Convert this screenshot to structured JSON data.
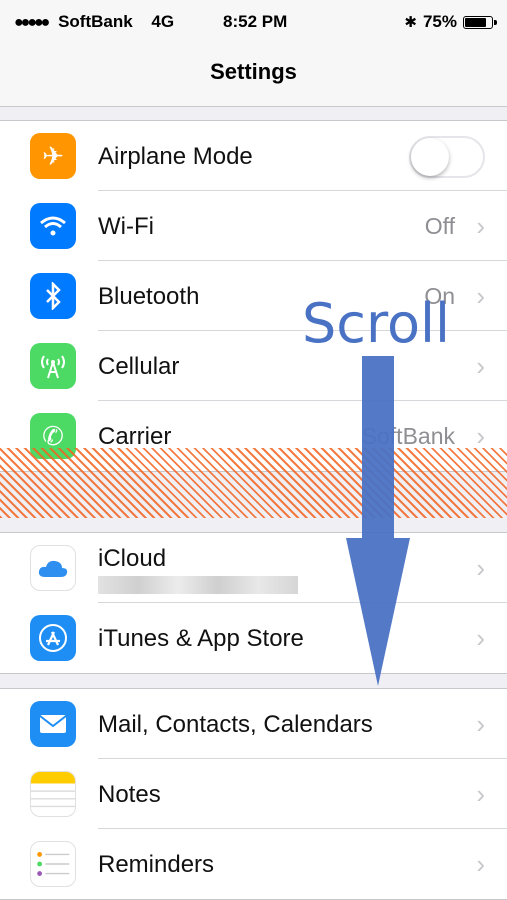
{
  "status": {
    "signal_dots": "●●●●●",
    "carrier": "SoftBank",
    "network": "4G",
    "time": "8:52 PM",
    "battery_percent": "75%",
    "battery_level": 0.75
  },
  "nav": {
    "title": "Settings"
  },
  "group1": [
    {
      "label": "Airplane Mode",
      "value": "",
      "icon": "airplane-icon",
      "color": "#ff9500",
      "glyph": "✈",
      "control": "toggle",
      "toggle_on": false
    },
    {
      "label": "Wi-Fi",
      "value": "Off",
      "icon": "wifi-icon",
      "color": "#007aff",
      "glyph": "≋"
    },
    {
      "label": "Bluetooth",
      "value": "On",
      "icon": "bluetooth-icon",
      "color": "#007aff",
      "glyph": "✱"
    },
    {
      "label": "Cellular",
      "value": "",
      "icon": "cellular-icon",
      "color": "#4cd964",
      "glyph": "Ⓐ"
    },
    {
      "label": "Carrier",
      "value": "SoftBank",
      "icon": "phone-icon",
      "color": "#4cd964",
      "glyph": "✆"
    }
  ],
  "group2": [
    {
      "label": "iCloud",
      "sublabel": "",
      "icon": "icloud-icon",
      "color": "#ffffff",
      "glyph": "☁"
    },
    {
      "label": "iTunes & App Store",
      "icon": "app-store-icon",
      "color": "#1e8ef5",
      "glyph": "Ⓐ"
    }
  ],
  "group3": [
    {
      "label": "Mail, Contacts, Calendars",
      "icon": "mail-icon",
      "color": "#1e8ef5",
      "glyph": "✉"
    },
    {
      "label": "Notes",
      "icon": "notes-icon",
      "color": "#ffffff",
      "glyph": ""
    },
    {
      "label": "Reminders",
      "icon": "reminders-icon",
      "color": "#ffffff",
      "glyph": ""
    }
  ],
  "overlay": {
    "text": "Scroll",
    "arrow_color": "#4a72c4"
  },
  "chevron": "›"
}
